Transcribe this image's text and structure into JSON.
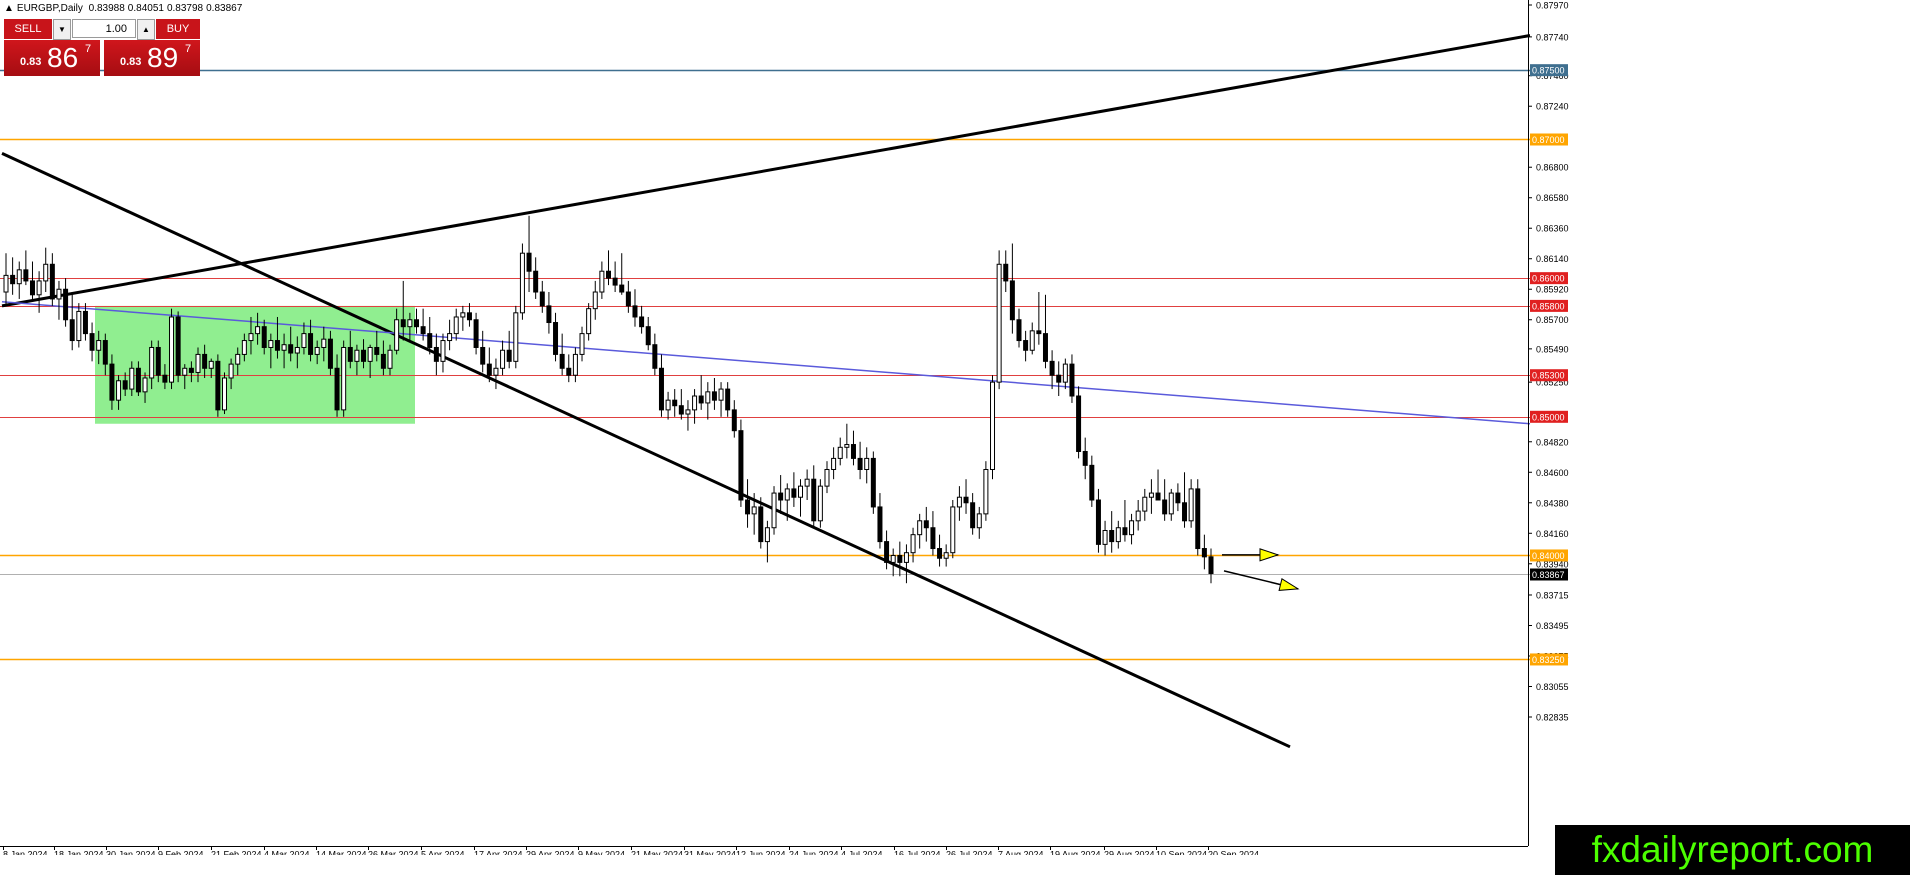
{
  "window": {
    "symbol_line": "EURGBP,Daily",
    "ohlc": [
      "0.83988",
      "0.84051",
      "0.83798",
      "0.83867"
    ]
  },
  "trade_panel": {
    "sell_label": "SELL",
    "buy_label": "BUY",
    "lot_size": "1.00",
    "sell_price_small": "0.83",
    "sell_price_big": "86",
    "sell_price_sup": "7",
    "buy_price_small": "0.83",
    "buy_price_big": "89",
    "buy_price_sup": "7"
  },
  "brand": "fxdailyreport.com",
  "colors": {
    "background": "#ffffff",
    "candle": "#000000",
    "resistance_red": "#e04040",
    "support_orange": "#ffa500",
    "level_blue": "#3f6f8f",
    "channel_line": "#5a5adb",
    "range_box": "#90ee90",
    "arrow_yellow": "#ffff00",
    "brand_bg": "#000000",
    "brand_text": "#4cff00"
  },
  "chart_data": {
    "type": "candlestick",
    "symbol": "EURGBP",
    "timeframe": "Daily",
    "ylim": [
      0.8262,
      0.8796
    ],
    "y_ticks": [
      "0.87970",
      "0.87740",
      "0.87460",
      "0.87240",
      "0.86800",
      "0.86580",
      "0.86360",
      "0.86140",
      "0.85920",
      "0.85700",
      "0.85490",
      "0.85250",
      "0.84820",
      "0.84600",
      "0.84380",
      "0.84160",
      "0.83940",
      "0.83715",
      "0.83495",
      "0.83275",
      "0.83055",
      "0.82835"
    ],
    "x_ticks": [
      "8 Jan 2024",
      "18 Jan 2024",
      "30 Jan 2024",
      "9 Feb 2024",
      "21 Feb 2024",
      "4 Mar 2024",
      "14 Mar 2024",
      "26 Mar 2024",
      "5 Apr 2024",
      "17 Apr 2024",
      "29 Apr 2024",
      "9 May 2024",
      "21 May 2024",
      "31 May 2024",
      "12 Jun 2024",
      "24 Jun 2024",
      "4 Jul 2024",
      "16 Jul 2024",
      "26 Jul 2024",
      "7 Aug 2024",
      "19 Aug 2024",
      "29 Aug 2024",
      "10 Sep 2024",
      "20 Sep 2024"
    ],
    "horizontal_levels": [
      {
        "price": 0.875,
        "label": "0.87500",
        "kind": "blue"
      },
      {
        "price": 0.87,
        "label": "0.87000",
        "kind": "orange"
      },
      {
        "price": 0.86,
        "label": "0.86000",
        "kind": "red"
      },
      {
        "price": 0.858,
        "label": "0.85800",
        "kind": "red"
      },
      {
        "price": 0.853,
        "label": "0.85300",
        "kind": "red"
      },
      {
        "price": 0.85,
        "label": "0.85000",
        "kind": "red"
      },
      {
        "price": 0.84,
        "label": "0.84000",
        "kind": "orange"
      },
      {
        "price": 0.8325,
        "label": "0.83250",
        "kind": "orange"
      }
    ],
    "current_price": {
      "price": 0.83867,
      "label": "0.83867"
    },
    "candles": [
      [
        0.859,
        0.8618,
        0.858,
        0.8602
      ],
      [
        0.8602,
        0.8615,
        0.8588,
        0.8596
      ],
      [
        0.8596,
        0.8612,
        0.8585,
        0.8606
      ],
      [
        0.8606,
        0.862,
        0.8595,
        0.8598
      ],
      [
        0.8598,
        0.8612,
        0.8583,
        0.8588
      ],
      [
        0.8588,
        0.8605,
        0.8575,
        0.8598
      ],
      [
        0.8598,
        0.8622,
        0.859,
        0.861
      ],
      [
        0.861,
        0.8618,
        0.858,
        0.8585
      ],
      [
        0.8585,
        0.8598,
        0.857,
        0.8592
      ],
      [
        0.8592,
        0.86,
        0.8565,
        0.857
      ],
      [
        0.857,
        0.859,
        0.8548,
        0.8555
      ],
      [
        0.8555,
        0.8582,
        0.855,
        0.8576
      ],
      [
        0.8576,
        0.8582,
        0.8555,
        0.856
      ],
      [
        0.856,
        0.8568,
        0.854,
        0.8548
      ],
      [
        0.8548,
        0.8562,
        0.8538,
        0.8555
      ],
      [
        0.8555,
        0.856,
        0.853,
        0.8538
      ],
      [
        0.8538,
        0.8545,
        0.8505,
        0.8512
      ],
      [
        0.8512,
        0.853,
        0.8505,
        0.8526
      ],
      [
        0.8526,
        0.8532,
        0.8515,
        0.852
      ],
      [
        0.852,
        0.854,
        0.8515,
        0.8535
      ],
      [
        0.8535,
        0.854,
        0.8515,
        0.8518
      ],
      [
        0.8518,
        0.8532,
        0.851,
        0.8528
      ],
      [
        0.8528,
        0.8555,
        0.852,
        0.855
      ],
      [
        0.855,
        0.8555,
        0.8525,
        0.853
      ],
      [
        0.853,
        0.8538,
        0.852,
        0.8525
      ],
      [
        0.8525,
        0.8578,
        0.852,
        0.8572
      ],
      [
        0.8572,
        0.8576,
        0.8525,
        0.853
      ],
      [
        0.853,
        0.8538,
        0.852,
        0.8535
      ],
      [
        0.8535,
        0.854,
        0.8525,
        0.8532
      ],
      [
        0.8532,
        0.855,
        0.8525,
        0.8545
      ],
      [
        0.8545,
        0.8552,
        0.8528,
        0.8535
      ],
      [
        0.8535,
        0.8542,
        0.8528,
        0.854
      ],
      [
        0.854,
        0.8545,
        0.85,
        0.8505
      ],
      [
        0.8505,
        0.8532,
        0.8502,
        0.8528
      ],
      [
        0.8528,
        0.8542,
        0.852,
        0.8538
      ],
      [
        0.8538,
        0.855,
        0.853,
        0.8545
      ],
      [
        0.8545,
        0.856,
        0.854,
        0.8555
      ],
      [
        0.8555,
        0.8572,
        0.8545,
        0.856
      ],
      [
        0.856,
        0.8575,
        0.8552,
        0.8565
      ],
      [
        0.8565,
        0.857,
        0.8545,
        0.855
      ],
      [
        0.855,
        0.856,
        0.8535,
        0.8555
      ],
      [
        0.8555,
        0.8572,
        0.8542,
        0.8548
      ],
      [
        0.8548,
        0.856,
        0.8535,
        0.8552
      ],
      [
        0.8552,
        0.8565,
        0.854,
        0.8546
      ],
      [
        0.8546,
        0.8558,
        0.8535,
        0.855
      ],
      [
        0.855,
        0.8568,
        0.8545,
        0.856
      ],
      [
        0.856,
        0.857,
        0.854,
        0.8545
      ],
      [
        0.8545,
        0.8555,
        0.8538,
        0.855
      ],
      [
        0.855,
        0.8565,
        0.854,
        0.8556
      ],
      [
        0.8556,
        0.8562,
        0.853,
        0.8535
      ],
      [
        0.8535,
        0.8545,
        0.85,
        0.8505
      ],
      [
        0.8505,
        0.8555,
        0.85,
        0.855
      ],
      [
        0.855,
        0.8562,
        0.8535,
        0.854
      ],
      [
        0.854,
        0.8552,
        0.853,
        0.8548
      ],
      [
        0.8548,
        0.8556,
        0.8535,
        0.854
      ],
      [
        0.854,
        0.8552,
        0.8528,
        0.855
      ],
      [
        0.855,
        0.8562,
        0.854,
        0.8545
      ],
      [
        0.8545,
        0.8555,
        0.853,
        0.8535
      ],
      [
        0.8535,
        0.8552,
        0.853,
        0.8548
      ],
      [
        0.8548,
        0.8578,
        0.8545,
        0.857
      ],
      [
        0.857,
        0.8598,
        0.8555,
        0.8565
      ],
      [
        0.8565,
        0.8575,
        0.8555,
        0.857
      ],
      [
        0.857,
        0.8578,
        0.856,
        0.8565
      ],
      [
        0.8565,
        0.8578,
        0.8555,
        0.856
      ],
      [
        0.856,
        0.8572,
        0.8545,
        0.855
      ],
      [
        0.855,
        0.856,
        0.853,
        0.854
      ],
      [
        0.854,
        0.856,
        0.8532,
        0.8555
      ],
      [
        0.8555,
        0.857,
        0.8548,
        0.856
      ],
      [
        0.856,
        0.8578,
        0.8555,
        0.8572
      ],
      [
        0.8572,
        0.858,
        0.8562,
        0.8575
      ],
      [
        0.8575,
        0.8582,
        0.8565,
        0.857
      ],
      [
        0.857,
        0.8575,
        0.8545,
        0.855
      ],
      [
        0.855,
        0.8562,
        0.8532,
        0.8538
      ],
      [
        0.8538,
        0.855,
        0.8525,
        0.853
      ],
      [
        0.853,
        0.8542,
        0.852,
        0.8535
      ],
      [
        0.8535,
        0.8555,
        0.853,
        0.8548
      ],
      [
        0.8548,
        0.8562,
        0.8535,
        0.854
      ],
      [
        0.854,
        0.858,
        0.8535,
        0.8575
      ],
      [
        0.8575,
        0.8625,
        0.857,
        0.8618
      ],
      [
        0.8618,
        0.8645,
        0.859,
        0.8605
      ],
      [
        0.8605,
        0.8615,
        0.8585,
        0.859
      ],
      [
        0.859,
        0.8598,
        0.8575,
        0.858
      ],
      [
        0.858,
        0.859,
        0.856,
        0.8568
      ],
      [
        0.8568,
        0.8575,
        0.854,
        0.8545
      ],
      [
        0.8545,
        0.856,
        0.853,
        0.8535
      ],
      [
        0.8535,
        0.8545,
        0.8525,
        0.853
      ],
      [
        0.853,
        0.855,
        0.8525,
        0.8545
      ],
      [
        0.8545,
        0.8565,
        0.854,
        0.856
      ],
      [
        0.856,
        0.8582,
        0.8555,
        0.8578
      ],
      [
        0.8578,
        0.8598,
        0.857,
        0.859
      ],
      [
        0.859,
        0.8612,
        0.8585,
        0.8605
      ],
      [
        0.8605,
        0.862,
        0.8595,
        0.86
      ],
      [
        0.86,
        0.8612,
        0.859,
        0.8595
      ],
      [
        0.8595,
        0.8618,
        0.8588,
        0.859
      ],
      [
        0.859,
        0.8598,
        0.8575,
        0.858
      ],
      [
        0.858,
        0.8592,
        0.8565,
        0.8572
      ],
      [
        0.8572,
        0.858,
        0.856,
        0.8565
      ],
      [
        0.8565,
        0.8572,
        0.8548,
        0.8552
      ],
      [
        0.8552,
        0.856,
        0.853,
        0.8535
      ],
      [
        0.8535,
        0.8545,
        0.85,
        0.8505
      ],
      [
        0.8505,
        0.8518,
        0.8498,
        0.8512
      ],
      [
        0.8512,
        0.852,
        0.85,
        0.8508
      ],
      [
        0.8508,
        0.852,
        0.8498,
        0.8502
      ],
      [
        0.8502,
        0.8512,
        0.849,
        0.8505
      ],
      [
        0.8505,
        0.852,
        0.8495,
        0.8515
      ],
      [
        0.8515,
        0.853,
        0.8505,
        0.851
      ],
      [
        0.851,
        0.8525,
        0.8498,
        0.8518
      ],
      [
        0.8518,
        0.8528,
        0.8505,
        0.8512
      ],
      [
        0.8512,
        0.8525,
        0.85,
        0.852
      ],
      [
        0.852,
        0.8525,
        0.85,
        0.8505
      ],
      [
        0.8505,
        0.8512,
        0.8485,
        0.849
      ],
      [
        0.849,
        0.8498,
        0.8435,
        0.844
      ],
      [
        0.844,
        0.8455,
        0.842,
        0.843
      ],
      [
        0.843,
        0.8445,
        0.8415,
        0.8435
      ],
      [
        0.8435,
        0.8442,
        0.8405,
        0.841
      ],
      [
        0.841,
        0.8425,
        0.8395,
        0.842
      ],
      [
        0.842,
        0.845,
        0.8415,
        0.8445
      ],
      [
        0.8445,
        0.8458,
        0.843,
        0.844
      ],
      [
        0.844,
        0.8452,
        0.8425,
        0.8448
      ],
      [
        0.8448,
        0.846,
        0.8435,
        0.8442
      ],
      [
        0.8442,
        0.8455,
        0.8428,
        0.845
      ],
      [
        0.845,
        0.8462,
        0.844,
        0.8455
      ],
      [
        0.8455,
        0.8465,
        0.842,
        0.8425
      ],
      [
        0.8425,
        0.8455,
        0.842,
        0.845
      ],
      [
        0.845,
        0.8468,
        0.8445,
        0.8462
      ],
      [
        0.8462,
        0.8478,
        0.8455,
        0.847
      ],
      [
        0.847,
        0.8485,
        0.8465,
        0.8478
      ],
      [
        0.8478,
        0.8495,
        0.847,
        0.848
      ],
      [
        0.848,
        0.849,
        0.8465,
        0.847
      ],
      [
        0.847,
        0.8482,
        0.8455,
        0.8462
      ],
      [
        0.8462,
        0.8478,
        0.8452,
        0.847
      ],
      [
        0.847,
        0.8475,
        0.843,
        0.8435
      ],
      [
        0.8435,
        0.8445,
        0.8405,
        0.841
      ],
      [
        0.841,
        0.8418,
        0.839,
        0.8395
      ],
      [
        0.8395,
        0.8405,
        0.8385,
        0.84
      ],
      [
        0.84,
        0.841,
        0.8385,
        0.8395
      ],
      [
        0.8395,
        0.8408,
        0.838,
        0.8402
      ],
      [
        0.8402,
        0.842,
        0.8395,
        0.8415
      ],
      [
        0.8415,
        0.843,
        0.8405,
        0.8425
      ],
      [
        0.8425,
        0.8435,
        0.841,
        0.842
      ],
      [
        0.842,
        0.8432,
        0.84,
        0.8405
      ],
      [
        0.8405,
        0.8415,
        0.8392,
        0.8398
      ],
      [
        0.8398,
        0.8408,
        0.8392,
        0.8402
      ],
      [
        0.8402,
        0.844,
        0.8398,
        0.8435
      ],
      [
        0.8435,
        0.845,
        0.8425,
        0.8442
      ],
      [
        0.8442,
        0.8455,
        0.843,
        0.8438
      ],
      [
        0.8438,
        0.8445,
        0.8415,
        0.842
      ],
      [
        0.842,
        0.8435,
        0.8412,
        0.843
      ],
      [
        0.843,
        0.8468,
        0.8425,
        0.8462
      ],
      [
        0.8462,
        0.853,
        0.8455,
        0.8525
      ],
      [
        0.8525,
        0.862,
        0.852,
        0.861
      ],
      [
        0.861,
        0.862,
        0.859,
        0.8598
      ],
      [
        0.8598,
        0.8625,
        0.856,
        0.857
      ],
      [
        0.857,
        0.8578,
        0.855,
        0.8555
      ],
      [
        0.8555,
        0.8562,
        0.854,
        0.8548
      ],
      [
        0.8548,
        0.8568,
        0.8545,
        0.8562
      ],
      [
        0.8562,
        0.859,
        0.8552,
        0.856
      ],
      [
        0.856,
        0.8588,
        0.8535,
        0.854
      ],
      [
        0.854,
        0.8548,
        0.852,
        0.853
      ],
      [
        0.853,
        0.854,
        0.8515,
        0.8525
      ],
      [
        0.8525,
        0.8542,
        0.852,
        0.8538
      ],
      [
        0.8538,
        0.8545,
        0.851,
        0.8515
      ],
      [
        0.8515,
        0.8522,
        0.847,
        0.8475
      ],
      [
        0.8475,
        0.8485,
        0.8455,
        0.8465
      ],
      [
        0.8465,
        0.8472,
        0.8435,
        0.844
      ],
      [
        0.844,
        0.8448,
        0.8402,
        0.8408
      ],
      [
        0.8408,
        0.8425,
        0.84,
        0.8418
      ],
      [
        0.8418,
        0.8432,
        0.8402,
        0.841
      ],
      [
        0.841,
        0.8425,
        0.8405,
        0.842
      ],
      [
        0.842,
        0.844,
        0.841,
        0.8415
      ],
      [
        0.8415,
        0.843,
        0.8408,
        0.8425
      ],
      [
        0.8425,
        0.844,
        0.8418,
        0.8432
      ],
      [
        0.8432,
        0.8448,
        0.8425,
        0.8442
      ],
      [
        0.8442,
        0.8455,
        0.843,
        0.8445
      ],
      [
        0.8445,
        0.8462,
        0.844,
        0.844
      ],
      [
        0.844,
        0.8455,
        0.8425,
        0.843
      ],
      [
        0.843,
        0.8448,
        0.8425,
        0.8445
      ],
      [
        0.8445,
        0.8452,
        0.8432,
        0.8438
      ],
      [
        0.8438,
        0.846,
        0.842,
        0.8425
      ],
      [
        0.8425,
        0.8455,
        0.842,
        0.8448
      ],
      [
        0.8448,
        0.8455,
        0.84,
        0.8405
      ],
      [
        0.8405,
        0.8415,
        0.839,
        0.8399
      ],
      [
        0.8399,
        0.8405,
        0.838,
        0.8387
      ]
    ],
    "trendlines": [
      {
        "name": "rising-trendline",
        "start": [
          "8 Jan 2024",
          0.858
        ],
        "end": [
          "20 Sep 2024+",
          0.8775
        ]
      },
      {
        "name": "falling-trendline",
        "start": [
          "8 Jan 2024",
          0.869
        ],
        "end": [
          "20 Sep 2024+",
          0.8262
        ]
      },
      {
        "name": "channel-line",
        "start": [
          "8 Jan 2024",
          0.8583
        ],
        "end": [
          "20 Sep 2024+",
          0.8495
        ]
      }
    ],
    "range_box": {
      "price_top": 0.858,
      "price_bottom": 0.8495
    },
    "arrows": 2,
    "grid": false
  }
}
